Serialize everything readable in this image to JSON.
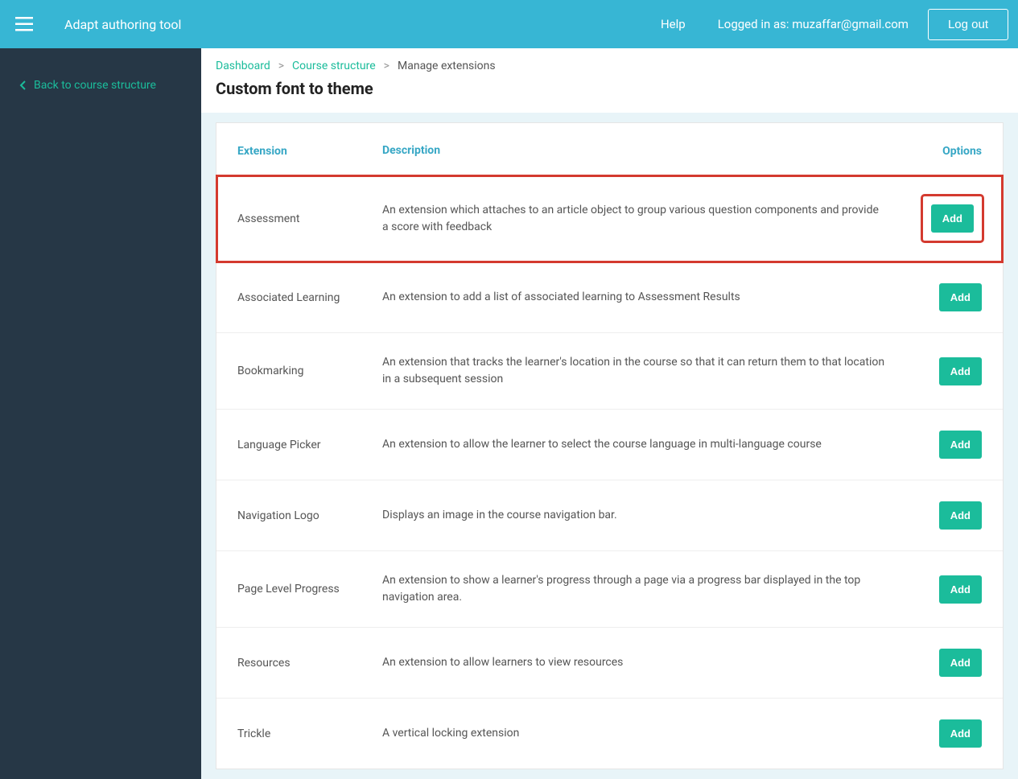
{
  "header": {
    "app_title": "Adapt authoring tool",
    "help_label": "Help",
    "logged_in_prefix": "Logged in as: ",
    "user_email": "muzaffar@gmail.com",
    "logout_label": "Log out"
  },
  "sidebar": {
    "back_label": "Back to course structure"
  },
  "breadcrumb": {
    "items": [
      "Dashboard",
      "Course structure",
      "Manage extensions"
    ]
  },
  "page_title": "Custom font to theme",
  "table": {
    "headers": {
      "extension": "Extension",
      "description": "Description",
      "options": "Options"
    },
    "add_label": "Add",
    "rows": [
      {
        "name": "Assessment",
        "desc": "An extension which attaches to an article object to group various question components and provide a score with feedback",
        "highlighted": true
      },
      {
        "name": "Associated Learning",
        "desc": "An extension to add a list of associated learning to Assessment Results",
        "highlighted": false
      },
      {
        "name": "Bookmarking",
        "desc": "An extension that tracks the learner's location in the course so that it can return them to that location in a subsequent session",
        "highlighted": false
      },
      {
        "name": "Language Picker",
        "desc": "An extension to allow the learner to select the course language in multi-language course",
        "highlighted": false
      },
      {
        "name": "Navigation Logo",
        "desc": "Displays an image in the course navigation bar.",
        "highlighted": false
      },
      {
        "name": "Page Level Progress",
        "desc": "An extension to show a learner's progress through a page via a progress bar displayed in the top navigation area.",
        "highlighted": false
      },
      {
        "name": "Resources",
        "desc": "An extension to allow learners to view resources",
        "highlighted": false
      },
      {
        "name": "Trickle",
        "desc": "A vertical locking extension",
        "highlighted": false
      }
    ]
  }
}
